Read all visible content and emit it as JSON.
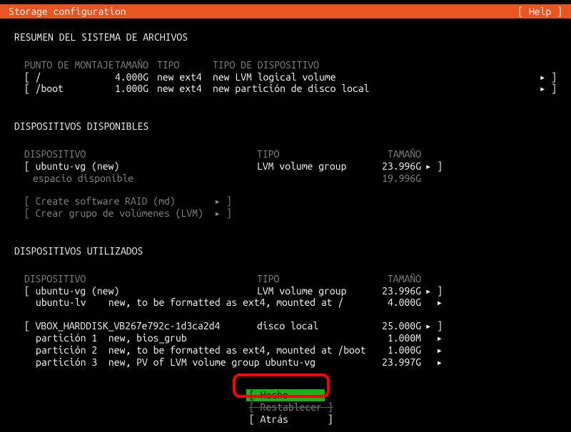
{
  "header": {
    "title": "Storage configuration",
    "help": "[ Help ]"
  },
  "fs_summary": {
    "title": "RESUMEN DEL SISTEMA DE ARCHIVOS",
    "columns": {
      "mount": "PUNTO DE MONTAJE",
      "size": "TAMAÑO",
      "type": "TIPO",
      "devtype": "TIPO DE DISPOSITIVO"
    },
    "rows": [
      {
        "mount": "[ /",
        "size": "4.000G",
        "type": "new ext4",
        "devtype": "new LVM logical volume",
        "arrow": "▸ ]"
      },
      {
        "mount": "[ /boot",
        "size": "1.000G",
        "type": "new ext4",
        "devtype": "new partición de disco local",
        "arrow": "▸ ]"
      }
    ]
  },
  "available": {
    "title": "DISPOSITIVOS DISPONIBLES",
    "columns": {
      "device": "DISPOSITIVO",
      "type": "TIPO",
      "size": "TAMAÑO"
    },
    "rows": [
      {
        "name": "[ ubuntu-vg (new)",
        "type": "LVM volume group",
        "size": "23.996G",
        "arrow": "▸ ]",
        "indent": false
      },
      {
        "name": "espacio disponible",
        "type": "",
        "size": "19.996G",
        "arrow": "",
        "indent": true,
        "muted": true
      }
    ],
    "options": [
      "[ Create software RAID (md)       ▸ ]",
      "[ Crear grupo de volúmenes (LVM)  ▸ ]"
    ]
  },
  "used": {
    "title": "DISPOSITIVOS UTILIZADOS",
    "columns": {
      "device": "DISPOSITIVO",
      "type": "TIPO",
      "size": "TAMAÑO"
    },
    "groups": [
      {
        "head": {
          "name": "[ ubuntu-vg (new)",
          "type": "LVM volume group",
          "size": "23.996G",
          "arrow": "▸ ]"
        },
        "children": [
          {
            "name": "ubuntu-lv    new, to be formatted as ext4, mounted at /",
            "type": "",
            "size": "4.000G",
            "arrow": "▸"
          }
        ]
      },
      {
        "head": {
          "name": "[ VBOX_HARDDISK_VB267e792c-1d3ca2d4",
          "type": "disco local",
          "size": "25.000G",
          "arrow": "▸ ]"
        },
        "children": [
          {
            "name": "partición 1  new, bios_grub",
            "type": "",
            "size": "1.000M",
            "arrow": "▸"
          },
          {
            "name": "partición 2  new, to be formatted as ext4, mounted at /boot",
            "type": "",
            "size": "1.000G",
            "arrow": "▸"
          },
          {
            "name": "partición 3  new, PV of LVM volume group ubuntu-vg",
            "type": "",
            "size": "23.997G",
            "arrow": "▸"
          }
        ]
      }
    ]
  },
  "buttons": {
    "done": "[ Hecho       ]",
    "reset": "[ Restablecer ]",
    "back": "[ Atrás       ]"
  }
}
